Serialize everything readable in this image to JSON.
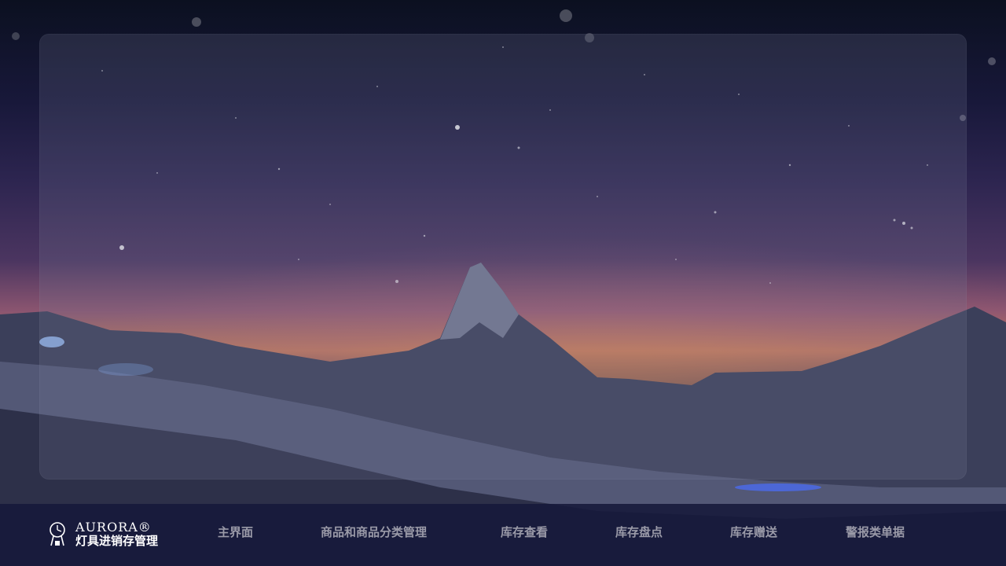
{
  "brand": {
    "name": "AURORA®",
    "subtitle": "灯具进销存管理"
  },
  "nav": {
    "items": [
      {
        "label": "主界面"
      },
      {
        "label": "商品和商品分类管理"
      },
      {
        "label": "库存查看"
      },
      {
        "label": "库存盘点"
      },
      {
        "label": "库存赠送"
      },
      {
        "label": "警报类单据"
      }
    ]
  },
  "colors": {
    "nav_background": "#16183a",
    "nav_text": "#9a9aa8",
    "brand_text": "#ffffff",
    "panel_tint": "#787d96"
  },
  "background": {
    "scene": "starry-night-mountain"
  }
}
